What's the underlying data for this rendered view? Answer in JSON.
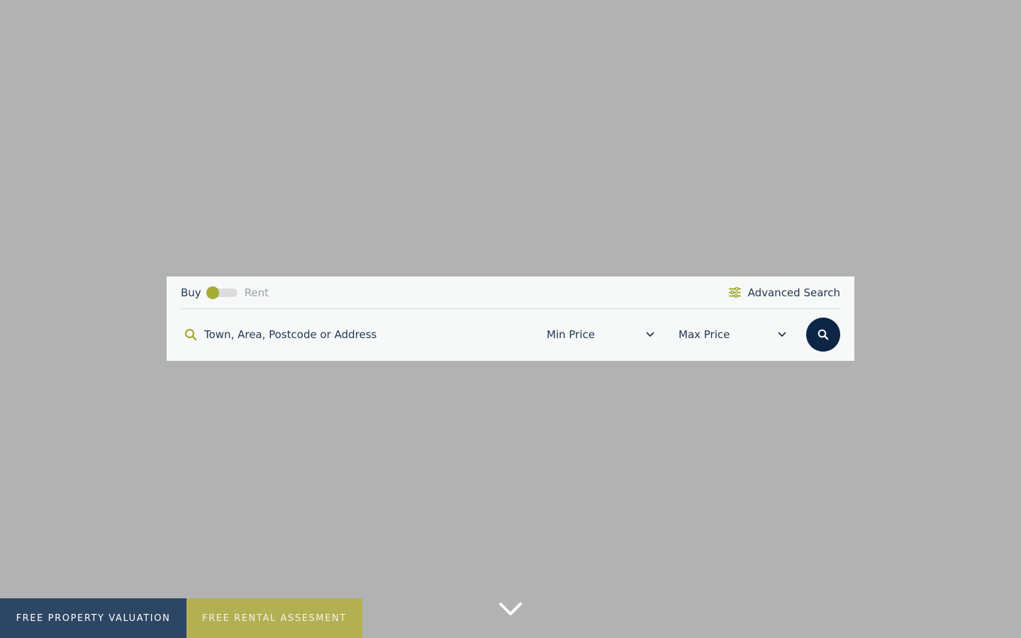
{
  "search": {
    "mode": {
      "buy_label": "Buy",
      "rent_label": "Rent",
      "selected": "Buy"
    },
    "advanced_label": "Advanced Search",
    "location_placeholder": "Town, Area, Postcode or Address",
    "min_price_label": "Min Price",
    "max_price_label": "Max Price"
  },
  "cta": {
    "valuation_label": "FREE PROPERTY VALUATION",
    "rental_label": "FREE RENTAL ASSESMENT"
  },
  "icons": {
    "search": "search-icon",
    "filters": "sliders-icon",
    "dropdown": "chevron-down-icon",
    "scroll": "chevron-down-icon"
  },
  "colors": {
    "background": "#b2b2b2",
    "panel": "#f7f8f8",
    "navy": "#0d2647",
    "text": "#1f3752",
    "accent": "#a5ac36",
    "valuation_bg": "#2c4663",
    "rental_bg": "#b2b052"
  }
}
